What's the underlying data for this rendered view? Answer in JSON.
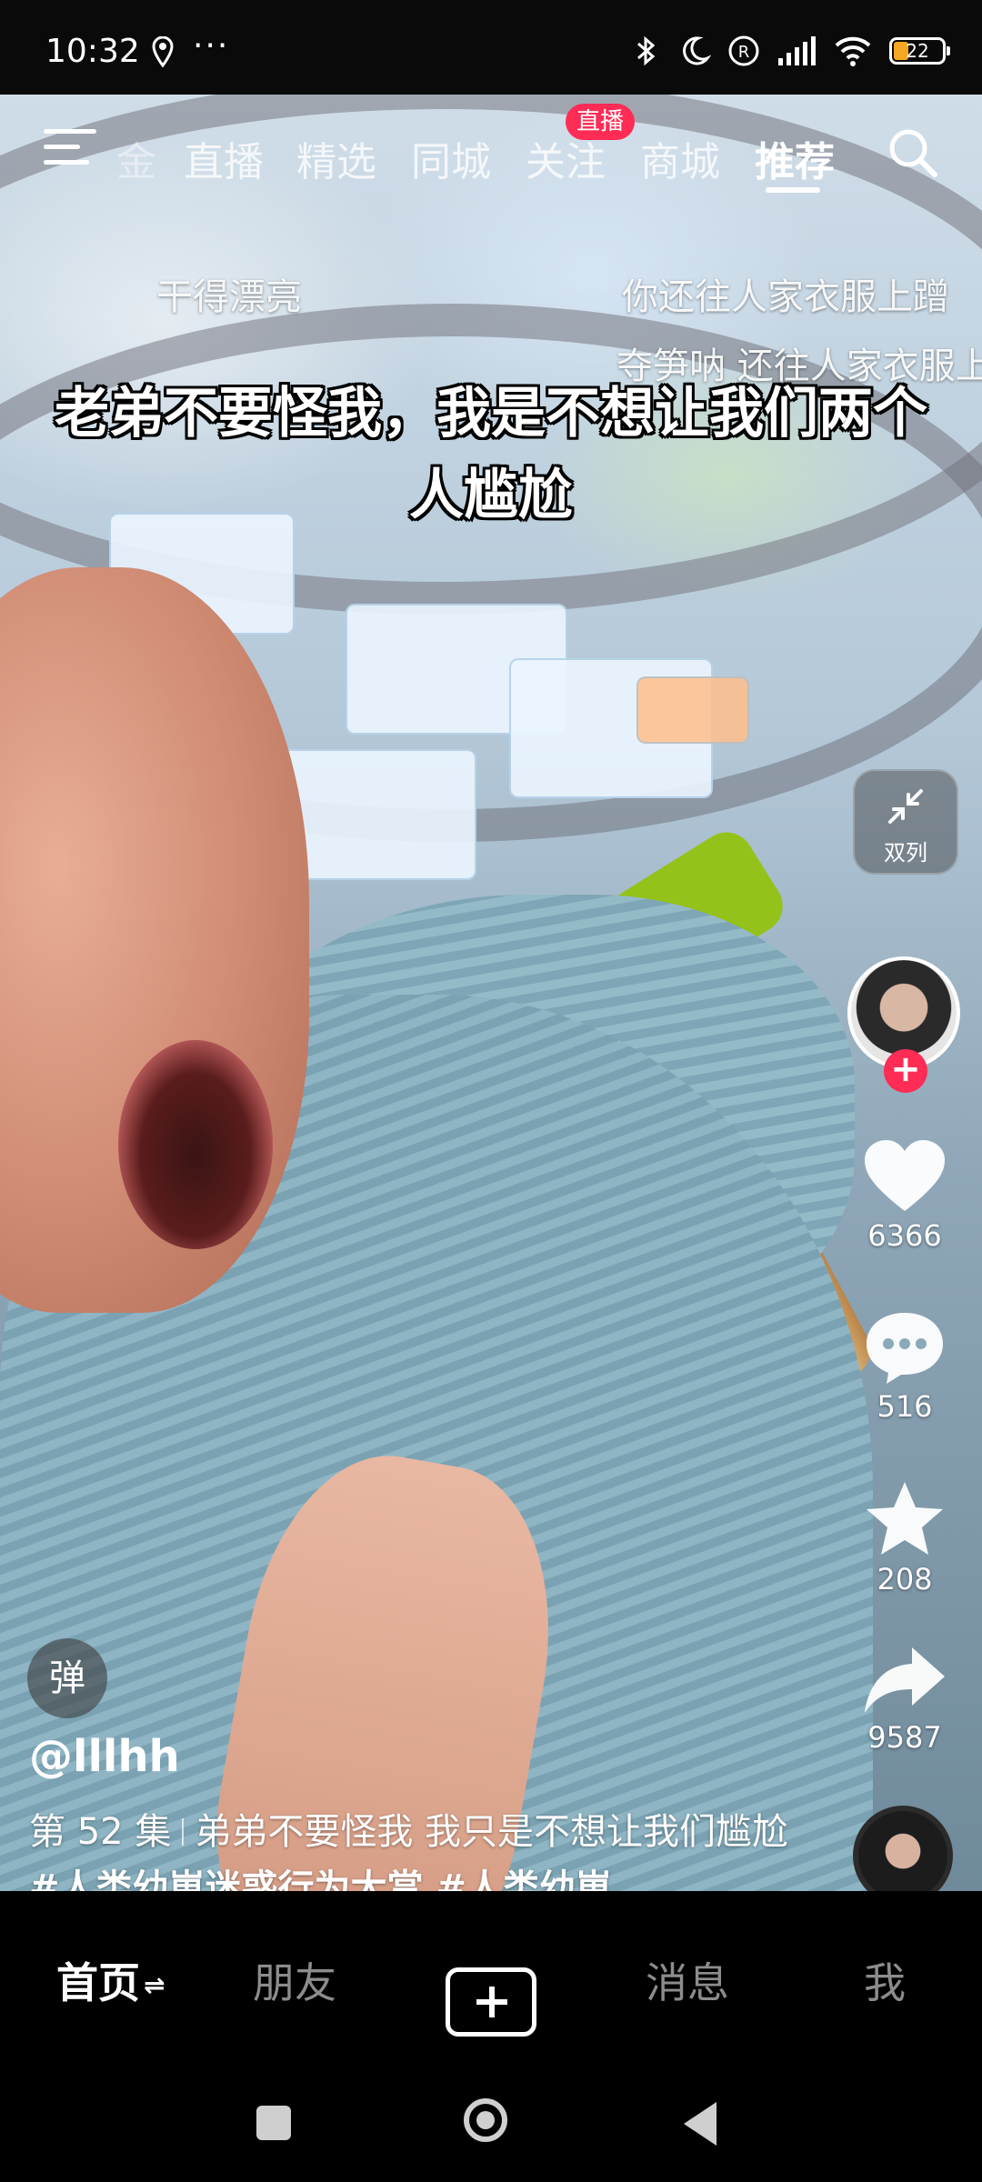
{
  "status_bar": {
    "time": "10:32",
    "dots": "···",
    "battery": "22",
    "icons": [
      "location-icon",
      "bluetooth-icon",
      "moon-icon",
      "registered-icon",
      "signal-icon",
      "wifi-icon",
      "battery-icon"
    ]
  },
  "top_nav": {
    "tabs": [
      "直播",
      "精选",
      "同城",
      "关注",
      "商城",
      "推荐"
    ],
    "active_tab": "推荐",
    "live_badge": "直播",
    "partial_tab_glyph": "金"
  },
  "danmaku": [
    "干得漂亮",
    "你还往人家衣服上蹭",
    "夺笋呐  还往人家衣服上"
  ],
  "subtitle": "老弟不要怪我，我是不想让我们两个人尴尬",
  "right_rail": {
    "dual_column_label": "双列",
    "likes": "6366",
    "comments": "516",
    "favorites": "208",
    "shares": "9587"
  },
  "bottom_info": {
    "danmu_button": "弹",
    "author": "@lllhh",
    "episode": "第 52 集",
    "caption_text": "弟弟不要怪我 我只是不想让我们尴尬",
    "hashtags": "#人类幼崽迷惑行为大赏 #人类幼崽"
  },
  "tab_bar": {
    "home": "首页",
    "friends": "朋友",
    "messages": "消息",
    "me": "我"
  },
  "colors": {
    "accent": "#ff2c55",
    "battery": "#f5a623",
    "background": "#000000"
  }
}
